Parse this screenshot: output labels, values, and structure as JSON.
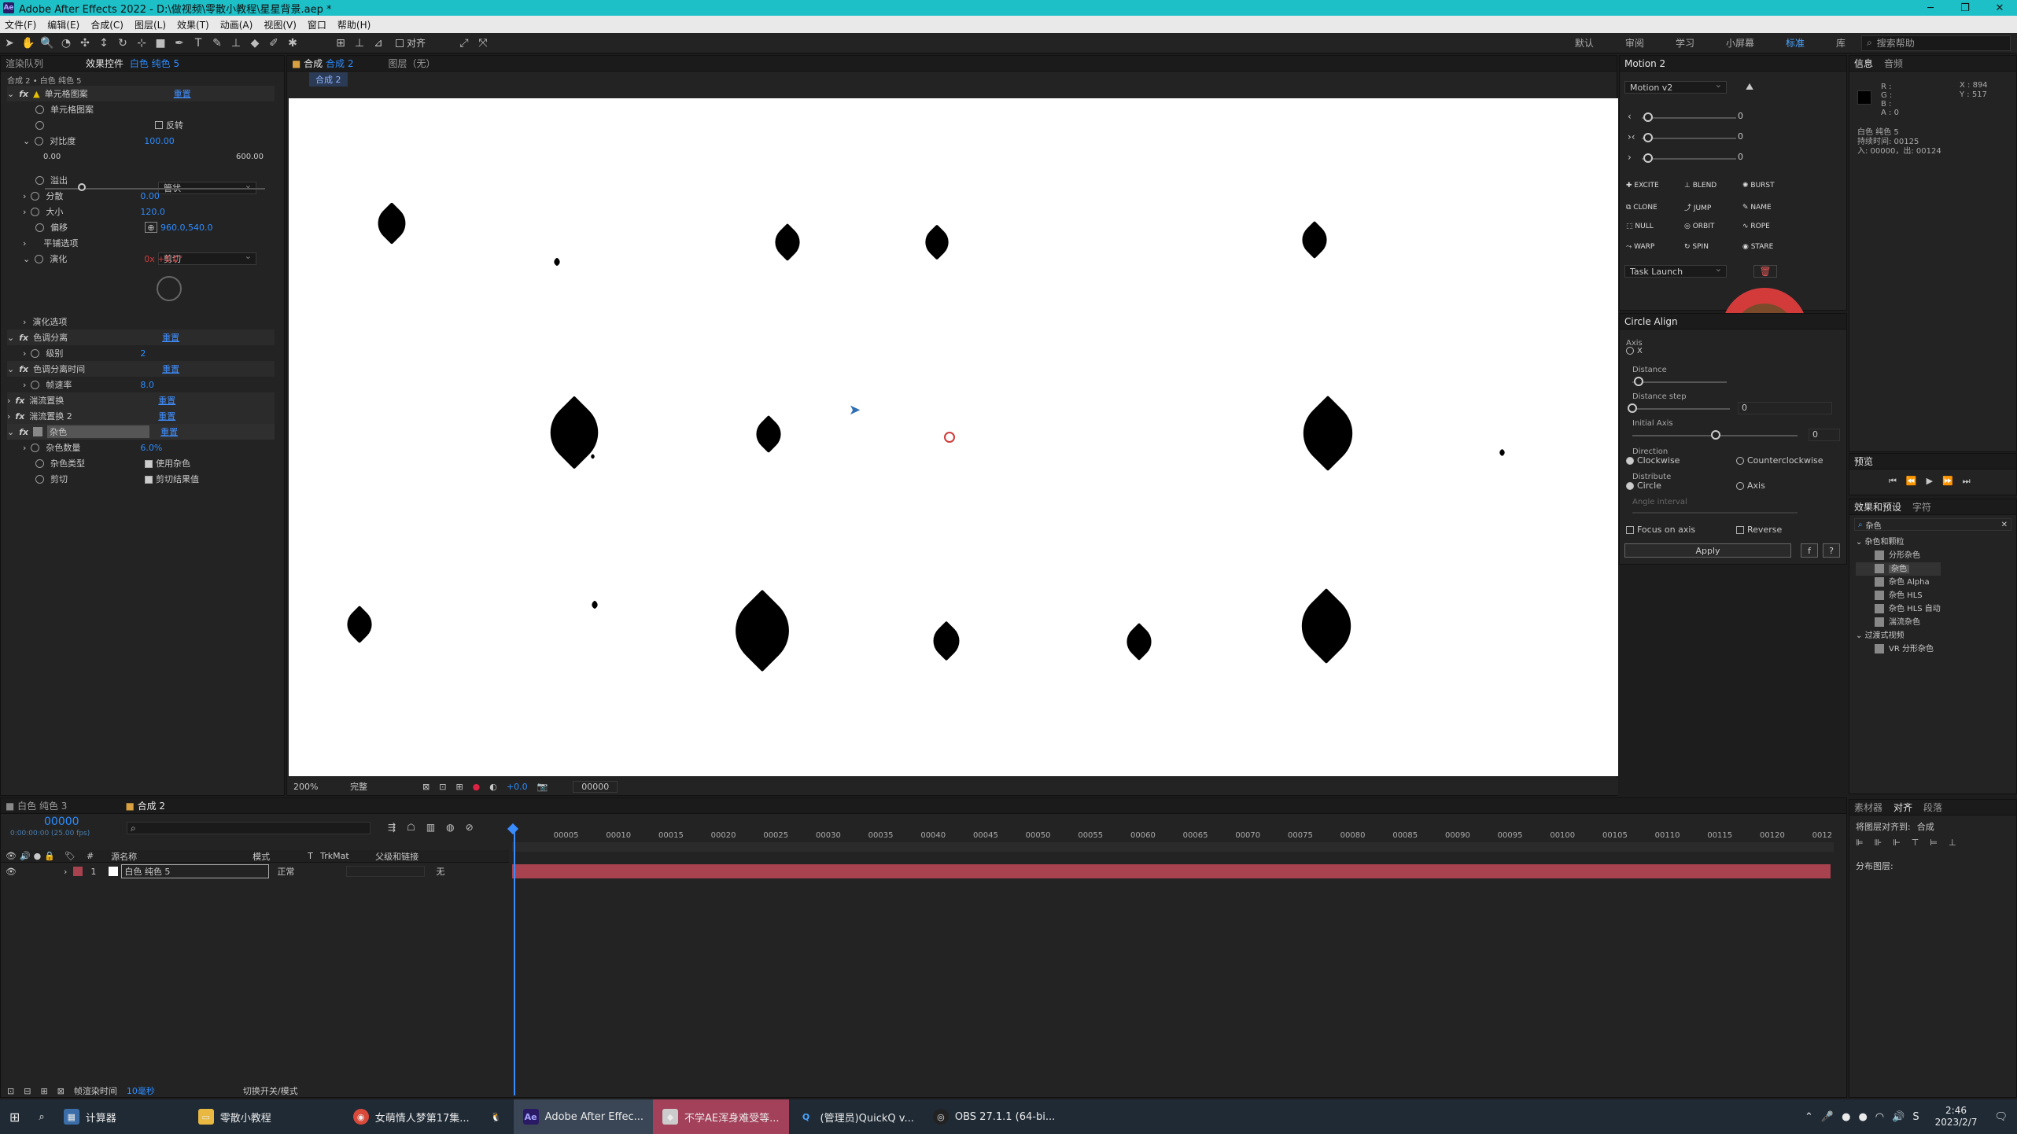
{
  "window": {
    "title": "Adobe After Effects 2022 - D:\\做视频\\零散小教程\\星星背景.aep *",
    "logo": "Ae",
    "minimize": "─",
    "maximize": "❐",
    "close": "✕"
  },
  "menu": [
    "文件(F)",
    "编辑(E)",
    "合成(C)",
    "图层(L)",
    "效果(T)",
    "动画(A)",
    "视图(V)",
    "窗口",
    "帮助(H)"
  ],
  "toolbar": {
    "align_label": "对齐",
    "workspaces": [
      "默认",
      "审阅",
      "学习",
      "小屏幕",
      "标准",
      "库"
    ],
    "active_workspace": "标准",
    "search_help": "搜索帮助"
  },
  "effects_panel": {
    "tab_render_queue": "渲染队列",
    "tab_effects": "效果控件",
    "layer_link": "白色 纯色 5",
    "breadcrumb": "合成 2 • 白色 纯色 5",
    "rows": [
      {
        "indent": 0,
        "fx": true,
        "label": "单元格图案",
        "value": "重置",
        "kind": "reset"
      },
      {
        "indent": 1,
        "label": "单元格图案",
        "value": "管状",
        "kind": "dropdown"
      },
      {
        "indent": 1,
        "label": "",
        "value": "反转",
        "kind": "checkbox"
      },
      {
        "indent": 1,
        "label": "对比度",
        "value": "100.00",
        "kind": "num"
      },
      {
        "indent": 2,
        "label": "0.00",
        "value": "600.00",
        "kind": "range"
      },
      {
        "indent": 1,
        "label": "溢出",
        "value": "剪切",
        "kind": "dropdown"
      },
      {
        "indent": 1,
        "label": "分散",
        "value": "0.00",
        "kind": "num"
      },
      {
        "indent": 1,
        "label": "大小",
        "value": "120.0",
        "kind": "num"
      },
      {
        "indent": 1,
        "label": "偏移",
        "value": "960.0,540.0",
        "kind": "num"
      },
      {
        "indent": 1,
        "label": "平铺选项",
        "value": "",
        "kind": "group"
      },
      {
        "indent": 1,
        "label": "演化",
        "value": "0x +0.0°",
        "kind": "numred"
      },
      {
        "indent": 1,
        "label": "演化选项",
        "value": "",
        "kind": "group"
      },
      {
        "indent": 0,
        "fx": true,
        "label": "色调分离",
        "value": "重置",
        "kind": "reset"
      },
      {
        "indent": 1,
        "label": "级别",
        "value": "2",
        "kind": "num"
      },
      {
        "indent": 0,
        "fx": true,
        "label": "色调分离时间",
        "value": "重置",
        "kind": "reset"
      },
      {
        "indent": 1,
        "label": "帧速率",
        "value": "8.0",
        "kind": "num"
      },
      {
        "indent": 0,
        "fx": true,
        "label": "湍流置换",
        "value": "重置",
        "kind": "reset"
      },
      {
        "indent": 0,
        "fx": true,
        "label": "湍流置换 2",
        "value": "重置",
        "kind": "reset"
      },
      {
        "indent": 0,
        "fx": true,
        "label": "杂色",
        "value": "重置",
        "kind": "reset"
      },
      {
        "indent": 1,
        "label": "杂色数量",
        "value": "6.0%",
        "kind": "num"
      },
      {
        "indent": 1,
        "label": "杂色类型",
        "value": "使用杂色",
        "kind": "checkbox_on"
      },
      {
        "indent": 1,
        "label": "剪切",
        "value": "剪切结果值",
        "kind": "checkbox_on"
      }
    ]
  },
  "comp_panel": {
    "tab_comp": "合成",
    "comp_name": "合成 2",
    "tab_layer": "图层（无）",
    "subtab": "合成 2",
    "zoom": "200%",
    "quality": "完整",
    "exposure": "+0.0",
    "timecode": "00000"
  },
  "motion_panel": {
    "title": "Motion 2",
    "version": "Motion v2",
    "values": [
      "0",
      "0",
      "0"
    ],
    "buttons": [
      [
        "EXCITE",
        "BLEND",
        "BURST"
      ],
      [
        "CLONE",
        "JUMP",
        "NAME"
      ],
      [
        "NULL",
        "ORBIT",
        "ROPE"
      ],
      [
        "WARP",
        "SPIN",
        "STARE"
      ]
    ],
    "task": "Task Launch"
  },
  "circle_align": {
    "title": "Circle Align",
    "axis": "Axis",
    "axis_x": "X",
    "distance": "Distance",
    "distance_step": "Distance step",
    "distance_step_val": "0",
    "initial_axis": "Initial Axis",
    "initial_axis_val": "0",
    "direction": "Direction",
    "clockwise": "Clockwise",
    "counterclockwise": "Counterclockwise",
    "distribute": "Distribute",
    "circle": "Circle",
    "axis_opt": "Axis",
    "angle_interval": "Angle interval",
    "focus_on_axis": "Focus on axis",
    "reverse": "Reverse",
    "apply": "Apply",
    "f": "f",
    "q": "?"
  },
  "info_panel": {
    "tab_info": "信息",
    "tab_audio": "音频",
    "rgba": [
      "R :",
      "G :",
      "B :",
      "A : 0"
    ],
    "x": "X : 894",
    "y": "Y : 517",
    "layer": "白色 纯色 5",
    "duration": "持续时间: 00125",
    "inout": "入: 00000，出: 00124"
  },
  "preview_panel": {
    "title": "预览"
  },
  "presets_panel": {
    "tab_effects": "效果和预设",
    "tab_char": "字符",
    "search": "杂色",
    "group1": "杂色和颗粒",
    "items1": [
      "分形杂色",
      "杂色",
      "杂色 Alpha",
      "杂色 HLS",
      "杂色 HLS 自动",
      "湍流杂色"
    ],
    "group2": "过渡式视频",
    "items2": [
      "VR 分形杂色"
    ]
  },
  "align_panel": {
    "tab_lib": "素材器",
    "tab_align": "对齐",
    "tab_other": "段落",
    "align_to": "将图层对齐到:",
    "align_to_val": "合成",
    "distribute": "分布图层:"
  },
  "timeline": {
    "tab1": "白色 纯色 3",
    "tab2": "合成 2",
    "timecode": "00000",
    "fps_info": "0:00:00:00 (25.00 fps)",
    "col_name": "源名称",
    "col_mode": "模式",
    "col_t": "T",
    "col_trkmat": "TrkMat",
    "col_parent": "父级和链接",
    "layer_num": "1",
    "layer_name": "白色 纯色 5",
    "layer_mode": "正常",
    "layer_parent": "无",
    "ticks": [
      "00005",
      "00010",
      "00015",
      "00020",
      "00025",
      "00030",
      "00035",
      "00040",
      "00045",
      "00050",
      "00055",
      "00060",
      "00065",
      "00070",
      "00075",
      "00080",
      "00085",
      "00090",
      "00095",
      "00100",
      "00105",
      "00110",
      "00115",
      "00120",
      "0012"
    ],
    "render_time_label": "帧渲染时间",
    "render_time": "10毫秒",
    "toggle_switches": "切换开关/模式"
  },
  "taskbar": {
    "items": [
      "计算器",
      "零散小教程",
      "女萌情人梦第17集...",
      "Adobe After Effec...",
      "不学AE浑身难受等...",
      "(管理员)QuickQ v...",
      "OBS 27.1.1 (64-bi..."
    ],
    "time": "2:46",
    "date": "2023/2/7"
  },
  "colors": {
    "accent": "#2d8cff",
    "titlebar": "#1ec0c8",
    "layer_bar": "#a8424f",
    "playhead": "#3a8cff"
  }
}
